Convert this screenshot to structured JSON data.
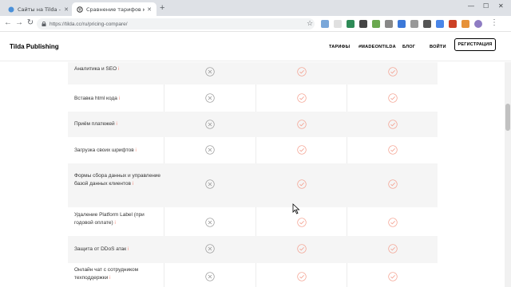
{
  "browser": {
    "tabs": [
      {
        "title": "Сайты на Tilda - курс для нови…",
        "active": false
      },
      {
        "title": "Сравнение тарифов конструкт…",
        "active": true
      }
    ],
    "url": "https://tilda.cc/ru/pricing-compare/"
  },
  "header": {
    "logo": "Tilda Publishing",
    "nav": [
      "ТАРИФЫ",
      "#MADEONTILDA",
      "БЛОГ",
      "ВОЙТИ"
    ],
    "register_label": "РЕГИСТРАЦИЯ"
  },
  "info_marker": "i",
  "features": [
    {
      "label": "Аналитика и SEO",
      "free": "no",
      "personal": "yes",
      "business": "yes"
    },
    {
      "label": "Вставка html кода",
      "free": "no",
      "personal": "yes",
      "business": "yes"
    },
    {
      "label": "Приём платежей",
      "free": "no",
      "personal": "yes",
      "business": "yes"
    },
    {
      "label": "Загрузка своих шрифтов",
      "free": "no",
      "personal": "yes",
      "business": "yes"
    },
    {
      "label": "Формы сбора данных и управление базой данных клиентов",
      "free": "no",
      "personal": "yes",
      "business": "yes"
    },
    {
      "label": "Удаление Platform Label (при годовой оплате)",
      "free": "no",
      "personal": "yes",
      "business": "yes"
    },
    {
      "label": "Защита от DDoS атак",
      "free": "no",
      "personal": "yes",
      "business": "yes"
    },
    {
      "label": "Онлайн чат с сотрудником техподдержки",
      "free": "no",
      "personal": "yes",
      "business": "yes"
    }
  ],
  "colors": {
    "check": "#f4a08f",
    "cross": "#9a9a9a",
    "accent": "#f78a7a"
  }
}
